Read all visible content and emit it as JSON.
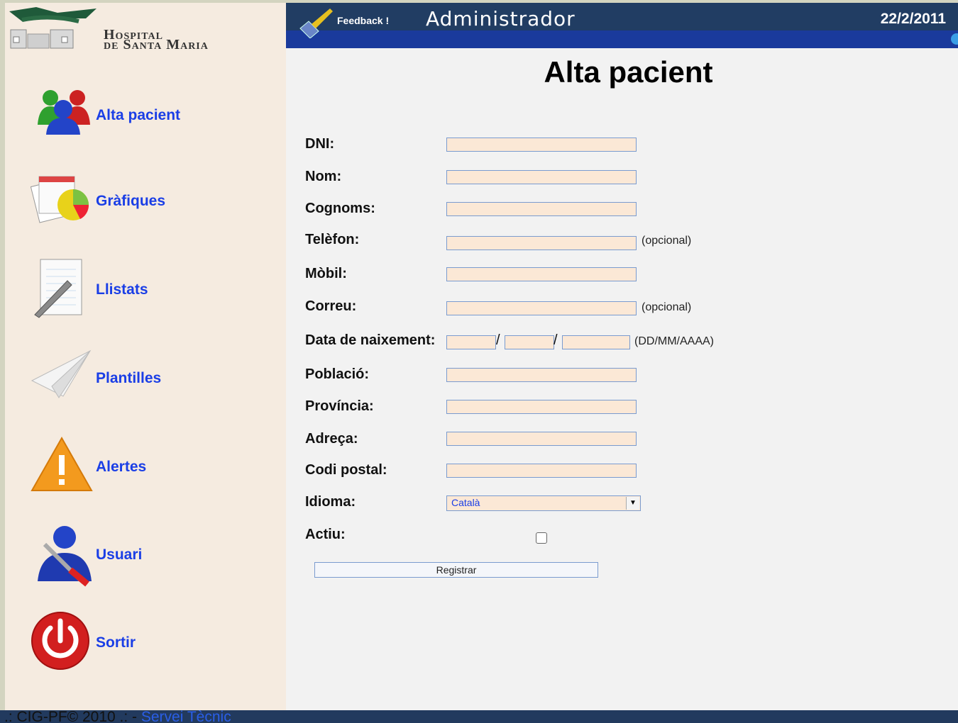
{
  "header": {
    "logo": {
      "line1": "Hospital",
      "line2": "de Santa Maria"
    },
    "feedback_label": "Feedback !",
    "title": "Administrador",
    "date": "22/2/2011"
  },
  "sidebar": {
    "items": [
      {
        "label": "Alta pacient",
        "icon": "users-icon"
      },
      {
        "label": "Gràfiques",
        "icon": "chart-icon"
      },
      {
        "label": "Llistats",
        "icon": "notepad-icon"
      },
      {
        "label": "Plantilles",
        "icon": "paper-plane-icon"
      },
      {
        "label": "Alertes",
        "icon": "warning-icon"
      },
      {
        "label": "Usuari",
        "icon": "user-settings-icon"
      },
      {
        "label": "Sortir",
        "icon": "power-icon"
      }
    ]
  },
  "main": {
    "title": "Alta pacient",
    "fields": {
      "dni": "DNI:",
      "nom": "Nom:",
      "cognoms": "Cognoms:",
      "telefon": "Telèfon:",
      "mobil": "Mòbil:",
      "correu": "Correu:",
      "data_naixement": "Data de naixement:",
      "poblacio": "Població:",
      "provincia": "Província:",
      "adreca": "Adreça:",
      "codi_postal": "Codi postal:",
      "idioma": "Idioma:",
      "actiu": "Actiu:"
    },
    "hints": {
      "optional": "(opcional)",
      "date_format": "(DD/MM/AAAA)",
      "slash": "/"
    },
    "idioma_value": "Català",
    "register_label": "Registrar"
  },
  "footer": {
    "text": ".: CIG-PF© 2010 .: - ",
    "link": "Servei Tècnic"
  },
  "colors": {
    "sidebar_bg": "#f5ebe0",
    "link_blue": "#1a3ee6",
    "header_bg": "#213d63",
    "input_bg": "#fbe8d6"
  }
}
